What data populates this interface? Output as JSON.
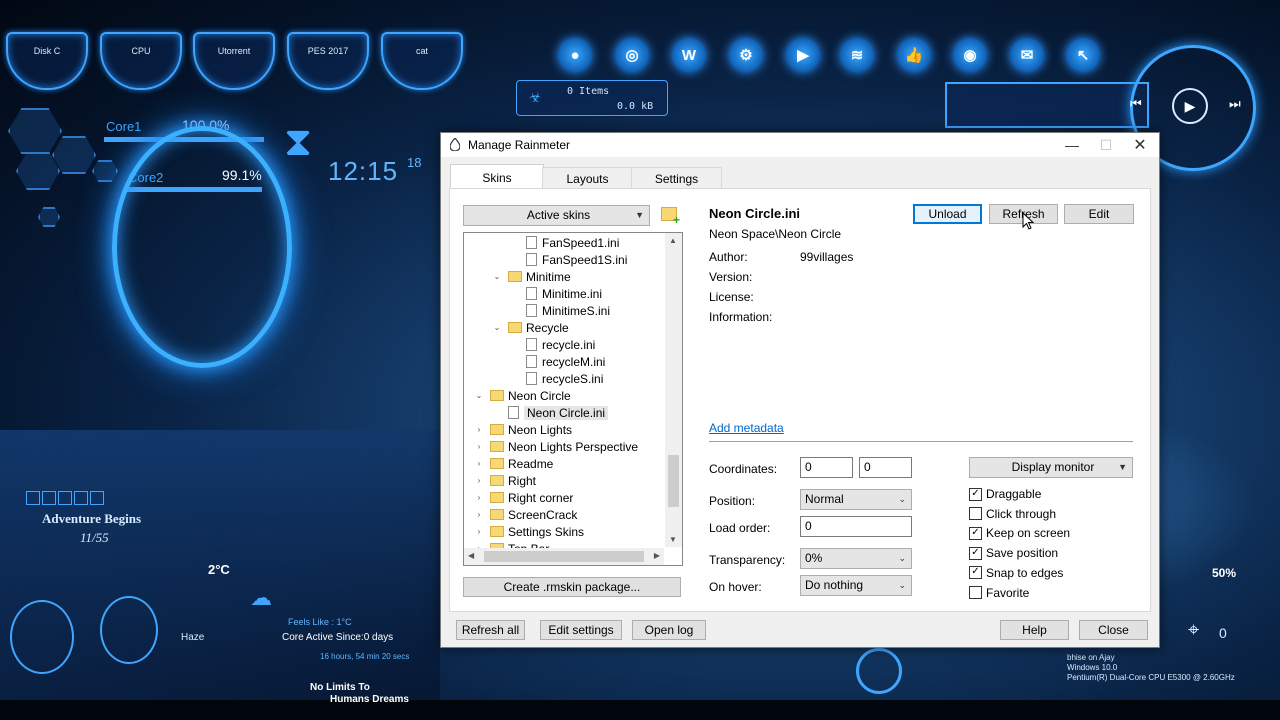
{
  "desktop": {
    "gauges": [
      "Disk C",
      "CPU",
      "Utorrent",
      "PES 2017",
      "cat"
    ],
    "recycle_items": "0 Items",
    "recycle_size": "0.0 kB",
    "core1_label": "Core1",
    "core1_value": "100.0%",
    "core2_label": "Core2",
    "core2_value": "99.1%",
    "clock_time": "12:15",
    "clock_seconds": "18",
    "adventure": "Adventure Begins",
    "date": "11/55",
    "temp": "2°C",
    "haze": "Haze",
    "feels_like": "Feels Like : 1°C",
    "core_active": "Core Active Since:0 days",
    "uptime": "16 hours, 54 min 20 secs",
    "no_limits_1": "No Limits To",
    "no_limits_2": "Humans Dreams",
    "volume": "50%",
    "zero": "0",
    "sysinfo": [
      "bhise on Ajay",
      "Windows 10.0",
      "Pentium(R) Dual-Core  CPU   E5300  @ 2.60GHz"
    ]
  },
  "window": {
    "title": "Manage Rainmeter",
    "tabs": [
      "Skins",
      "Layouts",
      "Settings"
    ],
    "active_skins_label": "Active skins",
    "tree": [
      {
        "label": "FanSpeed1.ini",
        "type": "file",
        "indent": 3
      },
      {
        "label": "FanSpeed1S.ini",
        "type": "file",
        "indent": 3
      },
      {
        "label": "Minitime",
        "type": "folder",
        "indent": 2,
        "exp": "open"
      },
      {
        "label": "Minitime.ini",
        "type": "file",
        "indent": 3
      },
      {
        "label": "MinitimeS.ini",
        "type": "file",
        "indent": 3
      },
      {
        "label": "Recycle",
        "type": "folder",
        "indent": 2,
        "exp": "open"
      },
      {
        "label": "recycle.ini",
        "type": "file",
        "indent": 3
      },
      {
        "label": "recycleM.ini",
        "type": "file",
        "indent": 3
      },
      {
        "label": "recycleS.ini",
        "type": "file",
        "indent": 3
      },
      {
        "label": "Neon Circle",
        "type": "folder",
        "indent": 1,
        "exp": "open"
      },
      {
        "label": "Neon Circle.ini",
        "type": "file",
        "indent": 2,
        "selected": true
      },
      {
        "label": "Neon Lights",
        "type": "folder",
        "indent": 1,
        "exp": "closed"
      },
      {
        "label": "Neon Lights Perspective",
        "type": "folder",
        "indent": 1,
        "exp": "closed"
      },
      {
        "label": "Readme",
        "type": "folder",
        "indent": 1,
        "exp": "closed"
      },
      {
        "label": "Right",
        "type": "folder",
        "indent": 1,
        "exp": "closed"
      },
      {
        "label": "Right corner",
        "type": "folder",
        "indent": 1,
        "exp": "closed"
      },
      {
        "label": "ScreenCrack",
        "type": "folder",
        "indent": 1,
        "exp": "closed"
      },
      {
        "label": "Settings Skins",
        "type": "folder",
        "indent": 1,
        "exp": "closed"
      },
      {
        "label": "Top Bar",
        "type": "folder",
        "indent": 1,
        "exp": "closed"
      }
    ],
    "create_package": "Create .rmskin package...",
    "skin_name": "Neon Circle.ini",
    "skin_path": "Neon Space\\Neon Circle",
    "unload": "Unload",
    "refresh": "Refresh",
    "edit": "Edit",
    "author_label": "Author:",
    "author_value": "99villages",
    "version_label": "Version:",
    "license_label": "License:",
    "information_label": "Information:",
    "add_metadata": "Add metadata",
    "coordinates_label": "Coordinates:",
    "coord_x": "0",
    "coord_y": "0",
    "position_label": "Position:",
    "position_value": "Normal",
    "load_order_label": "Load order:",
    "load_order_value": "0",
    "transparency_label": "Transparency:",
    "transparency_value": "0%",
    "on_hover_label": "On hover:",
    "on_hover_value": "Do nothing",
    "display_monitor": "Display monitor",
    "checks": [
      {
        "label": "Draggable",
        "checked": true
      },
      {
        "label": "Click through",
        "checked": false
      },
      {
        "label": "Keep on screen",
        "checked": true
      },
      {
        "label": "Save position",
        "checked": true
      },
      {
        "label": "Snap to edges",
        "checked": true
      },
      {
        "label": "Favorite",
        "checked": false
      }
    ],
    "refresh_all": "Refresh all",
    "edit_settings": "Edit settings",
    "open_log": "Open log",
    "help": "Help",
    "close": "Close"
  }
}
